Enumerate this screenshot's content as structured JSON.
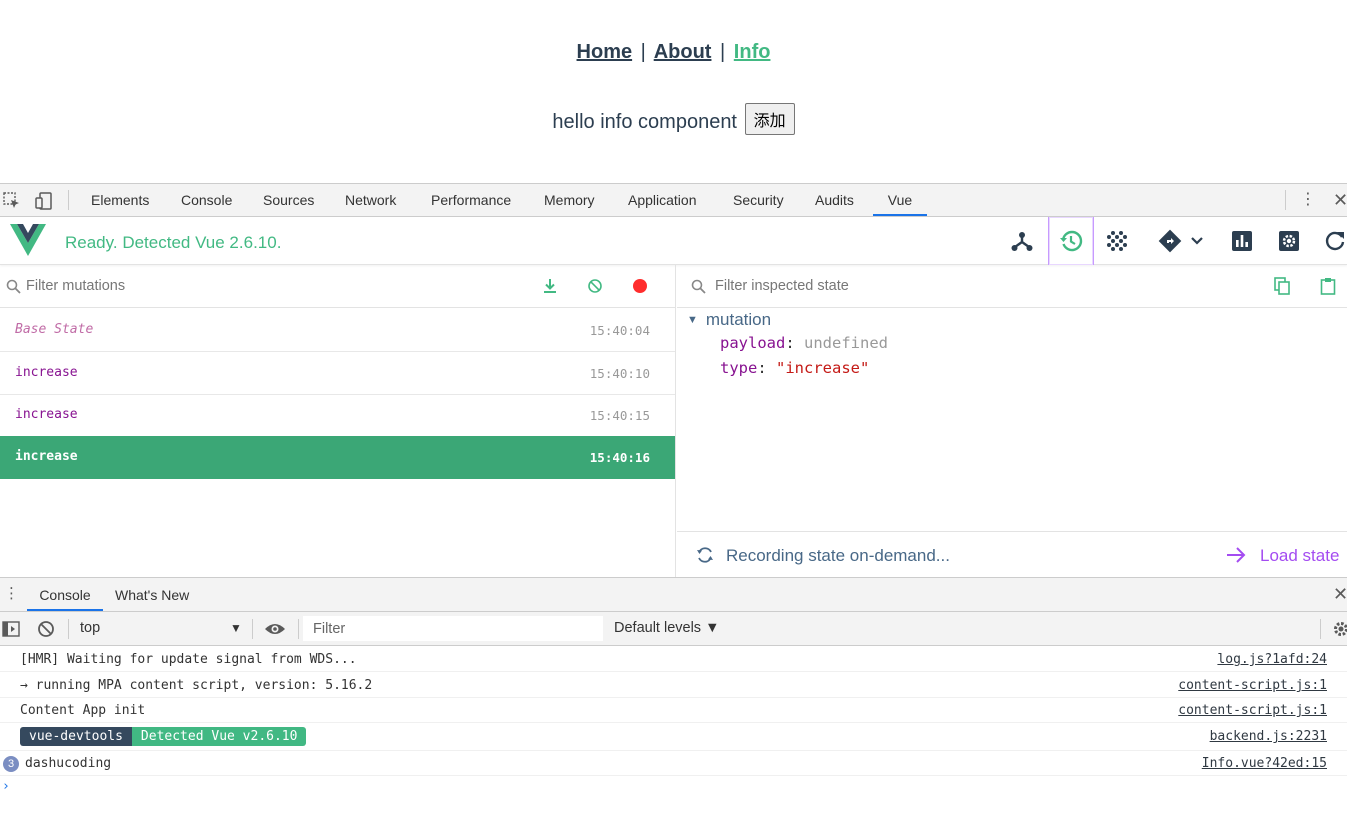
{
  "page": {
    "nav": {
      "home": "Home",
      "about": "About",
      "info": "Info",
      "separator": "|"
    },
    "hello_text": "hello info component",
    "add_button": "添加"
  },
  "devtools": {
    "tabs": [
      "Elements",
      "Console",
      "Sources",
      "Network",
      "Performance",
      "Memory",
      "Application",
      "Security",
      "Audits",
      "Vue"
    ],
    "active_tab": "Vue"
  },
  "vue": {
    "status": "Ready. Detected Vue 2.6.10.",
    "toolbar_icons": [
      "components-icon",
      "vuex-history-icon",
      "events-icon",
      "router-icon",
      "performance-icon",
      "settings-icon",
      "refresh-icon"
    ],
    "active_toolbar": "vuex-history-icon",
    "mutations": {
      "filter_placeholder": "Filter mutations",
      "items": [
        {
          "name": "Base State",
          "time": "15:40:04"
        },
        {
          "name": "increase",
          "time": "15:40:10"
        },
        {
          "name": "increase",
          "time": "15:40:15"
        },
        {
          "name": "increase",
          "time": "15:40:16"
        }
      ],
      "selected_index": 3
    },
    "inspector": {
      "filter_placeholder": "Filter inspected state",
      "root_label": "mutation",
      "payload_key": "payload",
      "payload_value": "undefined",
      "type_key": "type",
      "type_value": "\"increase\"",
      "recording_text": "Recording state on-demand...",
      "load_state": "Load state"
    }
  },
  "console": {
    "tabs": [
      "Console",
      "What's New"
    ],
    "context": "top",
    "filter_placeholder": "Filter",
    "levels": "Default levels ▼",
    "logs": [
      {
        "message": "[HMR] Waiting for update signal from WDS...",
        "source": "log.js?1afd:24"
      },
      {
        "message": "→ running MPA content script, version: 5.16.2",
        "source": "content-script.js:1"
      },
      {
        "message": "Content App init",
        "source": "content-script.js:1"
      },
      {
        "badge_left": "vue-devtools",
        "badge_right": "Detected Vue v2.6.10",
        "source": "backend.js:2231"
      },
      {
        "count": "3",
        "message": "dashucoding",
        "source": "Info.vue?42ed:15"
      }
    ],
    "prompt": "›"
  },
  "colors": {
    "vue_green": "#42b983",
    "selected_row": "#3ba776",
    "accent_purple": "#a44cf1",
    "tab_blue": "#1a73e8"
  }
}
